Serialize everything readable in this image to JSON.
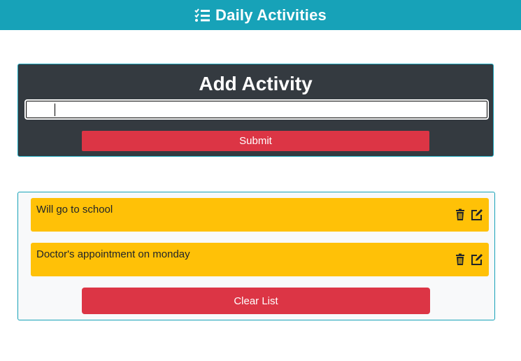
{
  "header": {
    "title": "Daily Activities",
    "icon": "tasks-icon",
    "background_color": "#17a2b8"
  },
  "add_form": {
    "heading": "Add Activity",
    "input_value": "",
    "submit_label": "Submit",
    "card_color": "#343a40",
    "button_color": "#dc3545"
  },
  "activities": {
    "items": [
      {
        "text": "Will go to school",
        "delete_icon": "trash-icon",
        "edit_icon": "edit-icon"
      },
      {
        "text": "Doctor's appointment on monday",
        "delete_icon": "trash-icon",
        "edit_icon": "edit-icon"
      }
    ],
    "item_color": "#ffc107",
    "clear_label": "Clear List"
  }
}
